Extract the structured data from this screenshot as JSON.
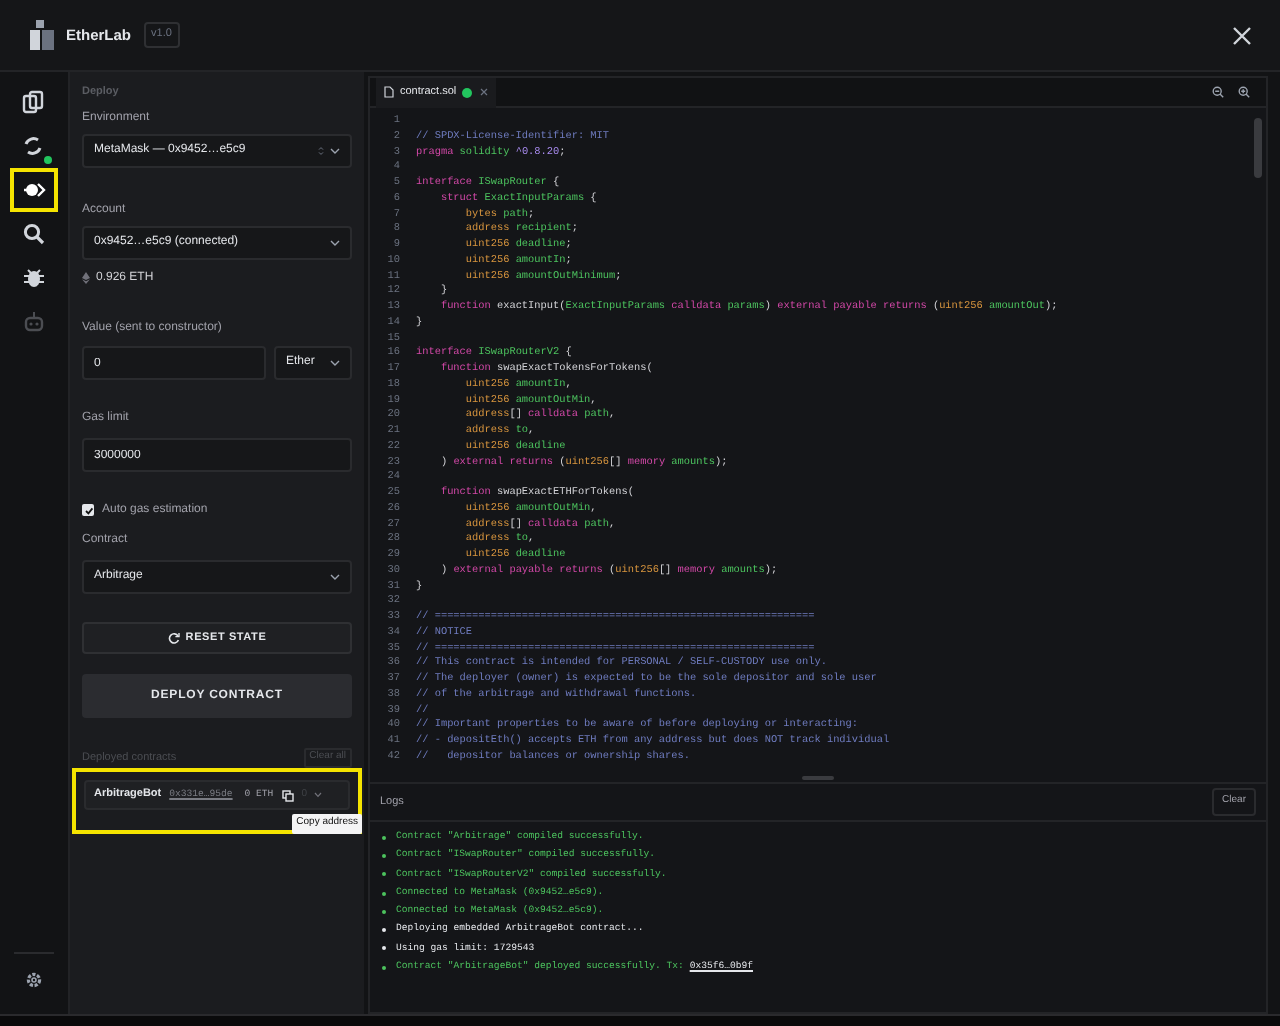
{
  "app": {
    "name": "EtherLab",
    "version": "v1.0"
  },
  "rail": [
    {
      "selected": false,
      "highlighted": false,
      "dot": false,
      "disabled": false
    },
    {
      "selected": false,
      "highlighted": false,
      "dot": true,
      "disabled": false
    },
    {
      "selected": true,
      "highlighted": true,
      "dot": false,
      "disabled": false
    },
    {
      "selected": false,
      "highlighted": false,
      "dot": false,
      "disabled": false
    },
    {
      "selected": false,
      "highlighted": false,
      "dot": false,
      "disabled": false
    },
    {
      "selected": false,
      "highlighted": false,
      "dot": false,
      "disabled": true
    }
  ],
  "deploy": {
    "title": "Deploy",
    "environment": {
      "label": "Environment",
      "value": "MetaMask — 0x9452…e5c9"
    },
    "account": {
      "label": "Account",
      "value": "0x9452…e5c9 (connected)",
      "balance": "0.926 ETH"
    },
    "value": {
      "label": "Value (sent to constructor)",
      "amount": "0",
      "unit": "Ether"
    },
    "gas": {
      "label": "Gas limit",
      "value": "3000000"
    },
    "auto_gas": {
      "label": "Auto gas estimation",
      "checked": true
    },
    "contract": {
      "label": "Contract",
      "value": "Arbitrage"
    },
    "reset_button": "RESET STATE",
    "deploy_button": "DEPLOY CONTRACT",
    "deployed": {
      "label": "Deployed contracts",
      "clear": "Clear all",
      "highlighted": true,
      "items": [
        {
          "name": "ArbitrageBot",
          "address": "0x331e…95de",
          "balance": "0 ETH",
          "count": "0",
          "tooltip": "Copy address"
        }
      ]
    }
  },
  "editor": {
    "tab": {
      "name": "contract.sol",
      "saved": true
    },
    "lines": [
      {
        "n": "1"
      },
      {
        "n": "2",
        "t": [
          {
            "kind": "comment",
            "text": "// SPDX-License-Identifier: MIT"
          }
        ]
      },
      {
        "n": "3",
        "t": [
          {
            "kind": "keyword",
            "text": "pragma "
          },
          {
            "kind": "ident",
            "text": "solidity "
          },
          {
            "kind": "version",
            "text": "^0.8.20"
          },
          {
            "kind": "plain",
            "text": ";"
          }
        ]
      },
      {
        "n": "4"
      },
      {
        "n": "5",
        "t": [
          {
            "kind": "keyword",
            "text": "interface "
          },
          {
            "kind": "ident",
            "text": "ISwapRouter "
          },
          {
            "kind": "plain",
            "text": "{"
          }
        ]
      },
      {
        "n": "6",
        "t": [
          {
            "kind": "keyword",
            "text": "    struct "
          },
          {
            "kind": "ident",
            "text": "ExactInputParams "
          },
          {
            "kind": "plain",
            "text": "{"
          }
        ]
      },
      {
        "n": "7",
        "t": [
          {
            "kind": "type",
            "text": "        bytes "
          },
          {
            "kind": "ident",
            "text": "path"
          },
          {
            "kind": "plain",
            "text": ";"
          }
        ]
      },
      {
        "n": "8",
        "t": [
          {
            "kind": "type",
            "text": "        address "
          },
          {
            "kind": "ident",
            "text": "recipient"
          },
          {
            "kind": "plain",
            "text": ";"
          }
        ]
      },
      {
        "n": "9",
        "t": [
          {
            "kind": "type",
            "text": "        uint256 "
          },
          {
            "kind": "ident",
            "text": "deadline"
          },
          {
            "kind": "plain",
            "text": ";"
          }
        ]
      },
      {
        "n": "10",
        "t": [
          {
            "kind": "type",
            "text": "        uint256 "
          },
          {
            "kind": "ident",
            "text": "amountIn"
          },
          {
            "kind": "plain",
            "text": ";"
          }
        ]
      },
      {
        "n": "11",
        "t": [
          {
            "kind": "type",
            "text": "        uint256 "
          },
          {
            "kind": "ident",
            "text": "amountOutMinimum"
          },
          {
            "kind": "plain",
            "text": ";"
          }
        ]
      },
      {
        "n": "12",
        "t": [
          {
            "kind": "plain",
            "text": "    }"
          }
        ]
      },
      {
        "n": "13",
        "t": [
          {
            "kind": "keyword",
            "text": "    function "
          },
          {
            "kind": "plain",
            "text": "exactInput("
          },
          {
            "kind": "ident",
            "text": "ExactInputParams "
          },
          {
            "kind": "keyword",
            "text": "calldata "
          },
          {
            "kind": "ident",
            "text": "params"
          },
          {
            "kind": "plain",
            "text": ") "
          },
          {
            "kind": "keyword",
            "text": "external payable returns "
          },
          {
            "kind": "plain",
            "text": "("
          },
          {
            "kind": "type",
            "text": "uint256 "
          },
          {
            "kind": "ident",
            "text": "amountOut"
          },
          {
            "kind": "plain",
            "text": ");"
          }
        ]
      },
      {
        "n": "14",
        "t": [
          {
            "kind": "plain",
            "text": "}"
          }
        ]
      },
      {
        "n": "15"
      },
      {
        "n": "16",
        "t": [
          {
            "kind": "keyword",
            "text": "interface "
          },
          {
            "kind": "ident",
            "text": "ISwapRouterV2 "
          },
          {
            "kind": "plain",
            "text": "{"
          }
        ]
      },
      {
        "n": "17",
        "t": [
          {
            "kind": "keyword",
            "text": "    function "
          },
          {
            "kind": "plain",
            "text": "swapExactTokensForTokens("
          }
        ]
      },
      {
        "n": "18",
        "t": [
          {
            "kind": "type",
            "text": "        uint256 "
          },
          {
            "kind": "ident",
            "text": "amountIn"
          },
          {
            "kind": "plain",
            "text": ","
          }
        ]
      },
      {
        "n": "19",
        "t": [
          {
            "kind": "type",
            "text": "        uint256 "
          },
          {
            "kind": "ident",
            "text": "amountOutMin"
          },
          {
            "kind": "plain",
            "text": ","
          }
        ]
      },
      {
        "n": "20",
        "t": [
          {
            "kind": "type",
            "text": "        address"
          },
          {
            "kind": "plain",
            "text": "[] "
          },
          {
            "kind": "keyword",
            "text": "calldata "
          },
          {
            "kind": "ident",
            "text": "path"
          },
          {
            "kind": "plain",
            "text": ","
          }
        ]
      },
      {
        "n": "21",
        "t": [
          {
            "kind": "type",
            "text": "        address "
          },
          {
            "kind": "ident",
            "text": "to"
          },
          {
            "kind": "plain",
            "text": ","
          }
        ]
      },
      {
        "n": "22",
        "t": [
          {
            "kind": "type",
            "text": "        uint256 "
          },
          {
            "kind": "ident",
            "text": "deadline"
          }
        ]
      },
      {
        "n": "23",
        "t": [
          {
            "kind": "plain",
            "text": "    ) "
          },
          {
            "kind": "keyword",
            "text": "external returns "
          },
          {
            "kind": "plain",
            "text": "("
          },
          {
            "kind": "type",
            "text": "uint256"
          },
          {
            "kind": "plain",
            "text": "[] "
          },
          {
            "kind": "keyword",
            "text": "memory "
          },
          {
            "kind": "ident",
            "text": "amounts"
          },
          {
            "kind": "plain",
            "text": ");"
          }
        ]
      },
      {
        "n": "24"
      },
      {
        "n": "25",
        "t": [
          {
            "kind": "keyword",
            "text": "    function "
          },
          {
            "kind": "plain",
            "text": "swapExactETHForTokens("
          }
        ]
      },
      {
        "n": "26",
        "t": [
          {
            "kind": "type",
            "text": "        uint256 "
          },
          {
            "kind": "ident",
            "text": "amountOutMin"
          },
          {
            "kind": "plain",
            "text": ","
          }
        ]
      },
      {
        "n": "27",
        "t": [
          {
            "kind": "type",
            "text": "        address"
          },
          {
            "kind": "plain",
            "text": "[] "
          },
          {
            "kind": "keyword",
            "text": "calldata "
          },
          {
            "kind": "ident",
            "text": "path"
          },
          {
            "kind": "plain",
            "text": ","
          }
        ]
      },
      {
        "n": "28",
        "t": [
          {
            "kind": "type",
            "text": "        address "
          },
          {
            "kind": "ident",
            "text": "to"
          },
          {
            "kind": "plain",
            "text": ","
          }
        ]
      },
      {
        "n": "29",
        "t": [
          {
            "kind": "type",
            "text": "        uint256 "
          },
          {
            "kind": "ident",
            "text": "deadline"
          }
        ]
      },
      {
        "n": "30",
        "t": [
          {
            "kind": "plain",
            "text": "    ) "
          },
          {
            "kind": "keyword",
            "text": "external payable returns "
          },
          {
            "kind": "plain",
            "text": "("
          },
          {
            "kind": "type",
            "text": "uint256"
          },
          {
            "kind": "plain",
            "text": "[] "
          },
          {
            "kind": "keyword",
            "text": "memory "
          },
          {
            "kind": "ident",
            "text": "amounts"
          },
          {
            "kind": "plain",
            "text": ");"
          }
        ]
      },
      {
        "n": "31",
        "t": [
          {
            "kind": "plain",
            "text": "}"
          }
        ]
      },
      {
        "n": "32"
      },
      {
        "n": "33",
        "t": [
          {
            "kind": "comment",
            "text": "// ============================================================="
          }
        ]
      },
      {
        "n": "34",
        "t": [
          {
            "kind": "comment",
            "text": "// NOTICE"
          }
        ]
      },
      {
        "n": "35",
        "t": [
          {
            "kind": "comment",
            "text": "// ============================================================="
          }
        ]
      },
      {
        "n": "36",
        "t": [
          {
            "kind": "comment",
            "text": "// This contract is intended for PERSONAL / SELF-CUSTODY use only."
          }
        ]
      },
      {
        "n": "37",
        "t": [
          {
            "kind": "comment",
            "text": "// The deployer (owner) is expected to be the sole depositor and sole user"
          }
        ]
      },
      {
        "n": "38",
        "t": [
          {
            "kind": "comment",
            "text": "// of the arbitrage and withdrawal functions."
          }
        ]
      },
      {
        "n": "39",
        "t": [
          {
            "kind": "comment",
            "text": "//"
          }
        ]
      },
      {
        "n": "40",
        "t": [
          {
            "kind": "comment",
            "text": "// Important properties to be aware of before deploying or interacting:"
          }
        ]
      },
      {
        "n": "41",
        "t": [
          {
            "kind": "comment",
            "text": "// - depositEth() accepts ETH from any address but does NOT track individual"
          }
        ]
      },
      {
        "n": "42",
        "t": [
          {
            "kind": "comment",
            "text": "//   depositor balances or ownership shares."
          }
        ]
      }
    ]
  },
  "logs": {
    "title": "Logs",
    "clear": "Clear",
    "entries": [
      {
        "kind": "success",
        "text": "Contract \"Arbitrage\" compiled successfully."
      },
      {
        "kind": "success",
        "text": "Contract \"ISwapRouter\" compiled successfully."
      },
      {
        "kind": "success",
        "text": "Contract \"ISwapRouterV2\" compiled successfully."
      },
      {
        "kind": "success",
        "text": "Connected to MetaMask (0x9452…e5c9)."
      },
      {
        "kind": "success",
        "text": "Connected to MetaMask (0x9452…e5c9)."
      },
      {
        "kind": "info",
        "text": "Deploying embedded ArbitrageBot contract..."
      },
      {
        "kind": "info",
        "text": "Using gas limit: 1729543"
      },
      {
        "kind": "success",
        "text": "Contract \"ArbitrageBot\" deployed successfully. Tx:",
        "link": "0x35f6…0b9f"
      }
    ]
  }
}
